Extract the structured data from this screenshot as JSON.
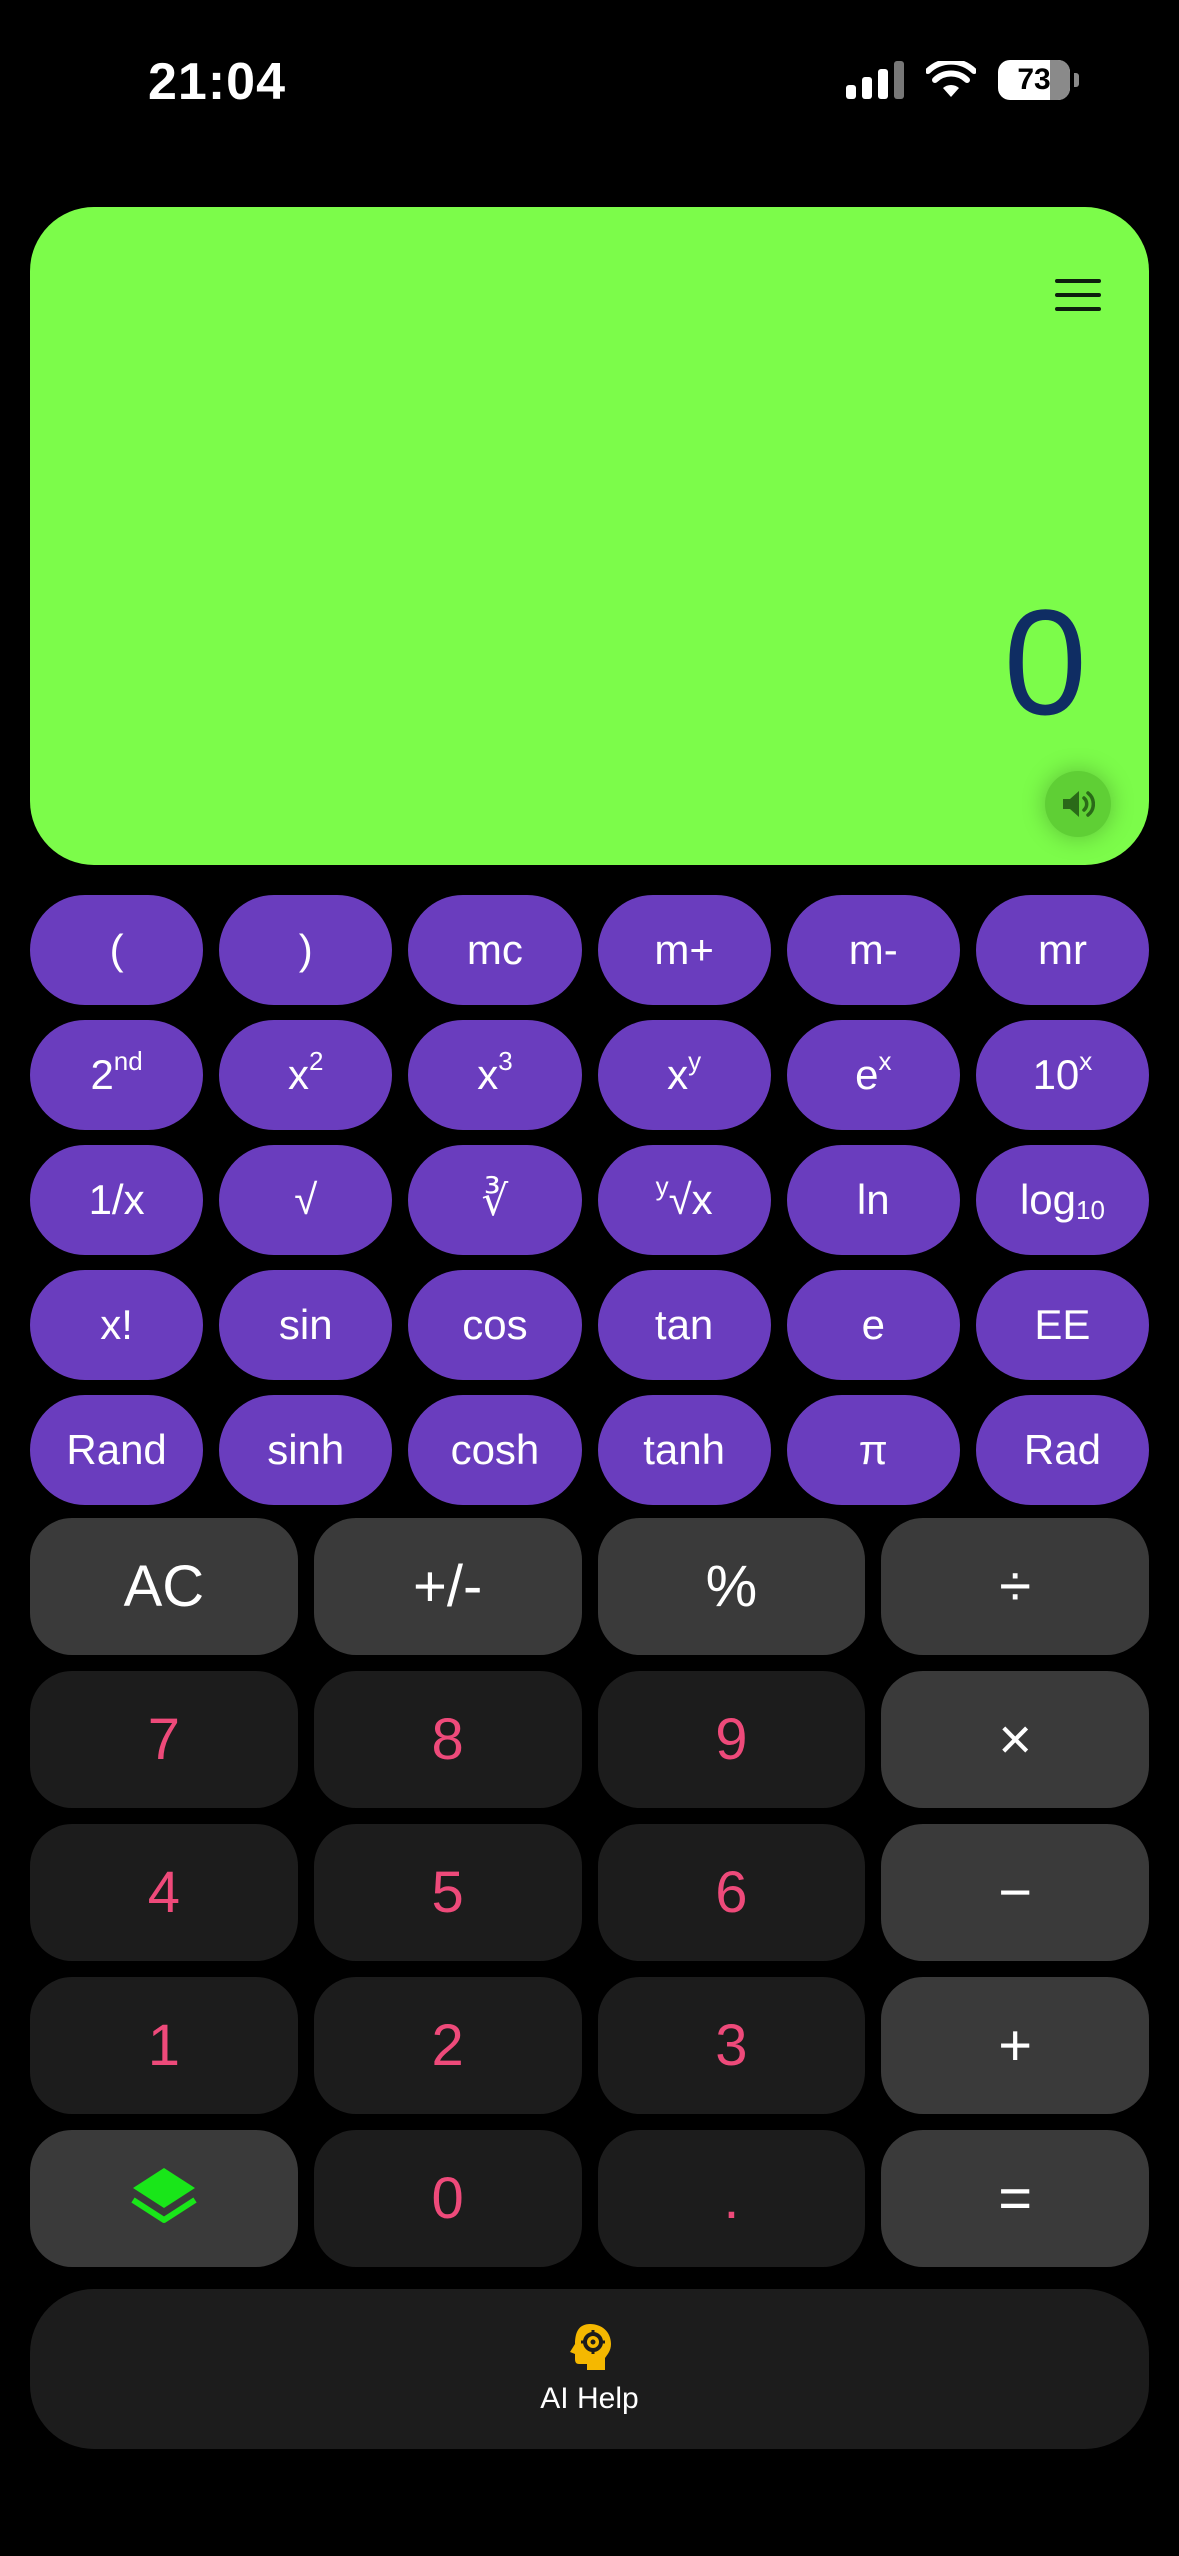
{
  "status_bar": {
    "time": "21:04",
    "battery": "73"
  },
  "display": {
    "value": "0"
  },
  "scientific": [
    [
      {
        "label": "("
      },
      {
        "label": ")"
      },
      {
        "label": "mc"
      },
      {
        "label": "m+"
      },
      {
        "label": "m-"
      },
      {
        "label": "mr"
      }
    ],
    [
      {
        "base": "2",
        "sup": "nd"
      },
      {
        "base": "x",
        "sup": "2"
      },
      {
        "base": "x",
        "sup": "3"
      },
      {
        "base": "x",
        "sup": "y"
      },
      {
        "base": "e",
        "sup": "x"
      },
      {
        "base": "10",
        "sup": "x"
      }
    ],
    [
      {
        "label": "1/x"
      },
      {
        "label": "√"
      },
      {
        "label": "∛"
      },
      {
        "pre": "y",
        "label": "√x"
      },
      {
        "label": "ln"
      },
      {
        "base": "log",
        "sub": "10"
      }
    ],
    [
      {
        "label": "x!"
      },
      {
        "label": "sin"
      },
      {
        "label": "cos"
      },
      {
        "label": "tan"
      },
      {
        "label": "e"
      },
      {
        "label": "EE"
      }
    ],
    [
      {
        "label": "Rand"
      },
      {
        "label": "sinh"
      },
      {
        "label": "cosh"
      },
      {
        "label": "tanh"
      },
      {
        "label": "π"
      },
      {
        "label": "Rad"
      }
    ]
  ],
  "keypad": {
    "row1": [
      "AC",
      "+/-",
      "%",
      "÷"
    ],
    "row2": [
      "7",
      "8",
      "9",
      "×"
    ],
    "row3": [
      "4",
      "5",
      "6",
      "−"
    ],
    "row4": [
      "1",
      "2",
      "3",
      "+"
    ],
    "row5": [
      "",
      "0",
      ".",
      "="
    ]
  },
  "ai_help": {
    "label": "AI Help"
  },
  "colors": {
    "display_bg": "#7cfc4a",
    "sci_button": "#6a3dbe",
    "digit_text": "#ee4a7a",
    "layers_icon": "#19e619",
    "ai_icon": "#f5b800"
  }
}
